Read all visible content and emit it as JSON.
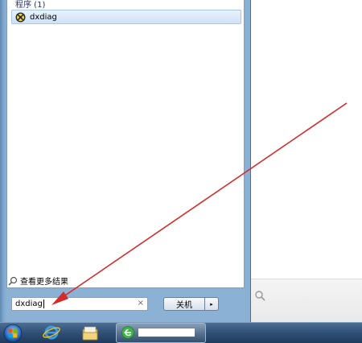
{
  "start_menu": {
    "group_header": "程序 (1)",
    "results": [
      {
        "label": "dxdiag",
        "icon": "dxdiag-icon"
      }
    ],
    "see_more": {
      "label": "查看更多结果",
      "icon": "search-icon"
    },
    "search": {
      "value": "dxdiag",
      "clear_symbol": "×"
    },
    "shutdown": {
      "label": "关机",
      "arrow": "▸"
    }
  },
  "taskbar": {
    "items": [
      {
        "name": "start-button",
        "icon": "windows-orb-icon"
      },
      {
        "name": "internet-explorer",
        "icon": "ie-icon"
      },
      {
        "name": "windows-explorer",
        "icon": "folder-icon"
      },
      {
        "name": "active-window",
        "icon": "browser-icon"
      }
    ]
  },
  "annotation": {
    "type": "arrow",
    "color": "#d42a2a"
  },
  "colors": {
    "menu_frame": "#7ea6cc",
    "selection": "#cfe2f7",
    "taskbar": "#2f4f75",
    "arrow": "#d42a2a"
  }
}
